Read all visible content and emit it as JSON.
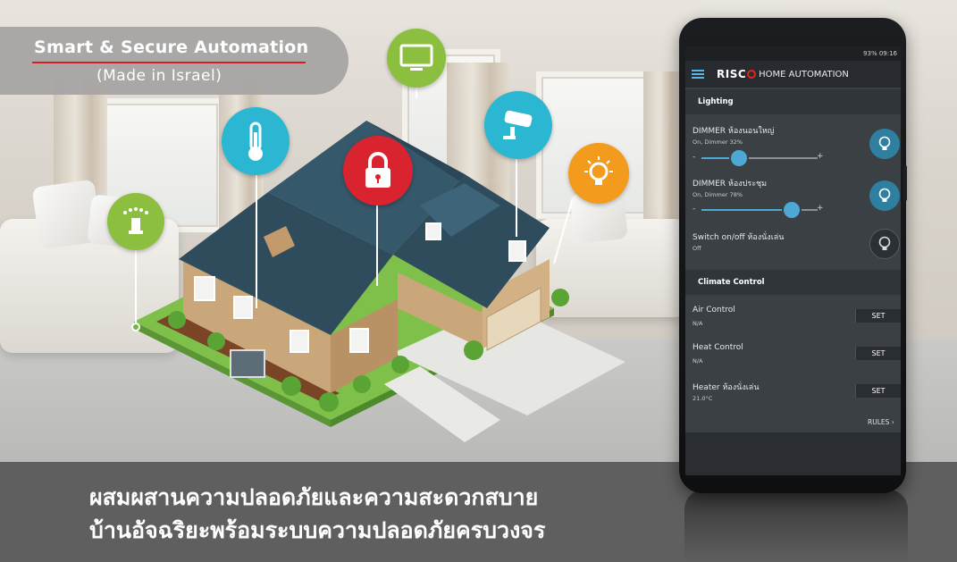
{
  "header": {
    "title": "Smart & Secure Automation",
    "subtitle": "(Made in Israel)"
  },
  "banner": {
    "line1": "ผสมผสานความปลอดภัยและความสะดวกสบาย",
    "line2": "บ้านอัจฉริยะพร้อมระบบความปลอดภัยครบวงจร"
  },
  "icons": [
    {
      "name": "sprinkler-icon",
      "color": "#8cbf3f"
    },
    {
      "name": "thermometer-icon",
      "color": "#2bb7d1"
    },
    {
      "name": "tv-icon",
      "color": "#8cbf3f"
    },
    {
      "name": "lock-icon",
      "color": "#d9232f"
    },
    {
      "name": "camera-icon",
      "color": "#2bb7d1"
    },
    {
      "name": "lightbulb-icon",
      "color": "#f39b1c"
    }
  ],
  "app": {
    "status": {
      "right": "93% 09:16"
    },
    "brand": "RISC",
    "title": "HOME AUTOMATION",
    "lighting": {
      "heading": "Lighting",
      "items": [
        {
          "title": "DIMMER ห้องนอนใหญ่",
          "status": "On, Dimmer 32%",
          "level": 32,
          "state": "on"
        },
        {
          "title": "DIMMER ห้องประชุม",
          "status": "On, Dimmer 78%",
          "level": 78,
          "state": "on"
        },
        {
          "title": "Switch on/off ห้องนั่งเล่น",
          "status": "Off",
          "state": "off"
        }
      ],
      "minus": "-",
      "plus": "+"
    },
    "climate": {
      "heading": "Climate Control",
      "items": [
        {
          "title": "Air Control",
          "value": "N/A",
          "button": "SET"
        },
        {
          "title": "Heat Control",
          "value": "N/A",
          "button": "SET"
        },
        {
          "title": "Heater ห้องนั่งเล่น",
          "value": "21.0°C",
          "button": "SET"
        }
      ]
    },
    "rules": "RULES"
  },
  "colors": {
    "accent_red": "#d21f26",
    "app_blue": "#4ea8d6",
    "banner_bg": "#5f5f5f"
  }
}
